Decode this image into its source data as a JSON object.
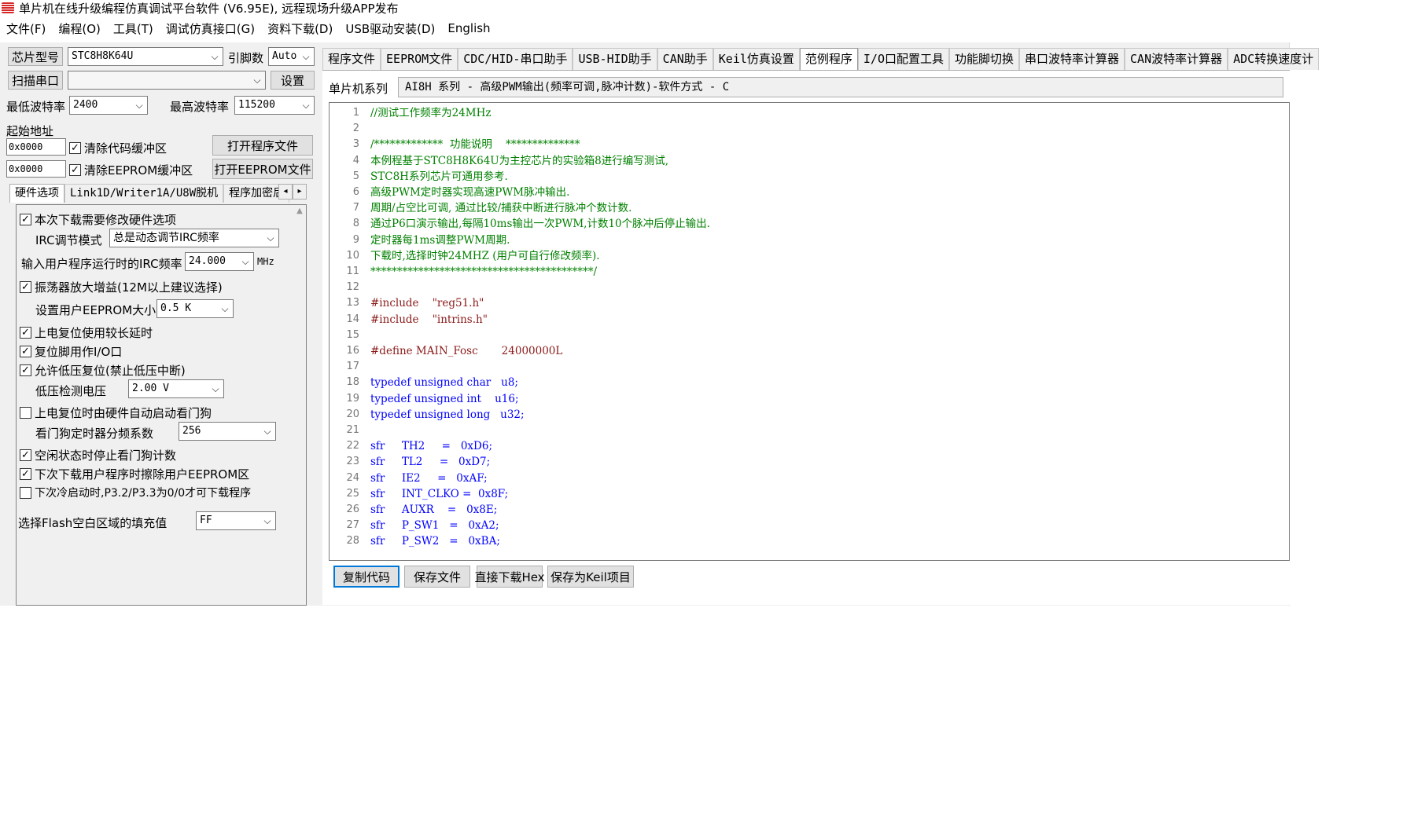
{
  "window": {
    "title": "单片机在线升级编程仿真调试平台软件 (V6.95E), 远程现场升级APP发布"
  },
  "menu": [
    "文件(F)",
    "编程(O)",
    "工具(T)",
    "调试仿真接口(G)",
    "资料下载(D)",
    "USB驱动安装(D)",
    "English"
  ],
  "left": {
    "chip_label": "芯片型号",
    "chip_value": "STC8H8K64U",
    "pins_label": "引脚数",
    "pins_value": "Auto",
    "scan_label": "扫描串口",
    "port_value": "",
    "settings_label": "设置",
    "min_baud_label": "最低波特率",
    "min_baud_value": "2400",
    "max_baud_label": "最高波特率",
    "max_baud_value": "115200",
    "start_addr_label": "起始地址",
    "addr1": "0x0000",
    "clear_code_label": "清除代码缓冲区",
    "open_prog_label": "打开程序文件",
    "addr2": "0x0000",
    "clear_eeprom_label": "清除EEPROM缓冲区",
    "open_eeprom_label": "打开EEPROM文件",
    "tabs": [
      "硬件选项",
      "Link1D/Writer1A/U8W脱机",
      "程序加密后"
    ],
    "scroll_left": "◂",
    "scroll_right": "▸",
    "hw": {
      "modify_hw": "本次下载需要修改硬件选项",
      "irc_mode_label": "IRC调节模式",
      "irc_mode_value": "总是动态调节IRC频率",
      "irc_freq_label": "输入用户程序运行时的IRC频率",
      "irc_freq_value": "24.000",
      "irc_freq_unit": "MHz",
      "osc_gain": "振荡器放大增益(12M以上建议选择)",
      "eeprom_size_label": "设置用户EEPROM大小",
      "eeprom_size_value": "0.5 K",
      "long_reset_delay": "上电复位使用较长延时",
      "reset_pin_io": "复位脚用作I/O口",
      "low_voltage_reset": "允许低压复位(禁止低压中断)",
      "lv_detect_label": "低压检测电压",
      "lv_detect_value": "2.00 V",
      "watchdog_auto": "上电复位时由硬件自动启动看门狗",
      "wdt_prescale_label": "看门狗定时器分频系数",
      "wdt_prescale_value": "256",
      "idle_stop_wdt": "空闲状态时停止看门狗计数",
      "erase_eeprom": "下次下载用户程序时擦除用户EEPROM区",
      "cold_boot": "下次冷启动时,P3.2/P3.3为0/0才可下载程序",
      "flash_fill_label": "选择Flash空白区域的填充值",
      "flash_fill_value": "FF"
    }
  },
  "right": {
    "tabs": [
      "程序文件",
      "EEPROM文件",
      "CDC/HID-串口助手",
      "USB-HID助手",
      "CAN助手",
      "Keil仿真设置",
      "范例程序",
      "I/O口配置工具",
      "功能脚切换",
      "串口波特率计算器",
      "CAN波特率计算器",
      "ADC转换速度计"
    ],
    "active_tab": "范例程序",
    "series_label": "单片机系列",
    "series_value": "AI8H 系列 - 高级PWM输出(频率可调,脉冲计数)-软件方式 - C",
    "code": [
      {
        "n": "1",
        "t": "//测试工作频率为24MHz",
        "k": "comment"
      },
      {
        "n": "2",
        "t": "",
        "k": "plain"
      },
      {
        "n": "3",
        "t": "/*************  功能说明    **************",
        "k": "comment"
      },
      {
        "n": "4",
        "t": "本例程基于STC8H8K64U为主控芯片的实验箱8进行编写测试,",
        "k": "comment"
      },
      {
        "n": "5",
        "t": "STC8H系列芯片可通用参考.",
        "k": "comment"
      },
      {
        "n": "6",
        "t": "高级PWM定时器实现高速PWM脉冲输出.",
        "k": "comment"
      },
      {
        "n": "7",
        "t": "周期/占空比可调, 通过比较/捕获中断进行脉冲个数计数.",
        "k": "comment"
      },
      {
        "n": "8",
        "t": "通过P6口演示输出,每隔10ms输出一次PWM,计数10个脉冲后停止输出.",
        "k": "comment"
      },
      {
        "n": "9",
        "t": "定时器每1ms调整PWM周期.",
        "k": "comment"
      },
      {
        "n": "10",
        "t": "下载时,选择时钟24MHZ (用户可自行修改频率).",
        "k": "comment"
      },
      {
        "n": "11",
        "t": "******************************************/",
        "k": "comment"
      },
      {
        "n": "12",
        "t": "",
        "k": "plain"
      },
      {
        "n": "13",
        "t": "#include    \"reg51.h\"",
        "k": "pre"
      },
      {
        "n": "14",
        "t": "#include    \"intrins.h\"",
        "k": "pre"
      },
      {
        "n": "15",
        "t": "",
        "k": "plain"
      },
      {
        "n": "16",
        "t": "#define MAIN_Fosc       24000000L",
        "k": "pre"
      },
      {
        "n": "17",
        "t": "",
        "k": "plain"
      },
      {
        "n": "18",
        "t": "typedef unsigned char   u8;",
        "k": "kw"
      },
      {
        "n": "19",
        "t": "typedef unsigned int    u16;",
        "k": "kw"
      },
      {
        "n": "20",
        "t": "typedef unsigned long   u32;",
        "k": "kw"
      },
      {
        "n": "21",
        "t": "",
        "k": "plain"
      },
      {
        "n": "22",
        "t": "sfr     TH2     =   0xD6;",
        "k": "kw"
      },
      {
        "n": "23",
        "t": "sfr     TL2     =   0xD7;",
        "k": "kw"
      },
      {
        "n": "24",
        "t": "sfr     IE2     =   0xAF;",
        "k": "kw"
      },
      {
        "n": "25",
        "t": "sfr     INT_CLKO =  0x8F;",
        "k": "kw"
      },
      {
        "n": "26",
        "t": "sfr     AUXR    =   0x8E;",
        "k": "kw"
      },
      {
        "n": "27",
        "t": "sfr     P_SW1   =   0xA2;",
        "k": "kw"
      },
      {
        "n": "28",
        "t": "sfr     P_SW2   =   0xBA;",
        "k": "kw"
      }
    ],
    "buttons": [
      "复制代码",
      "保存文件",
      "直接下载Hex",
      "保存为Keil项目"
    ]
  }
}
